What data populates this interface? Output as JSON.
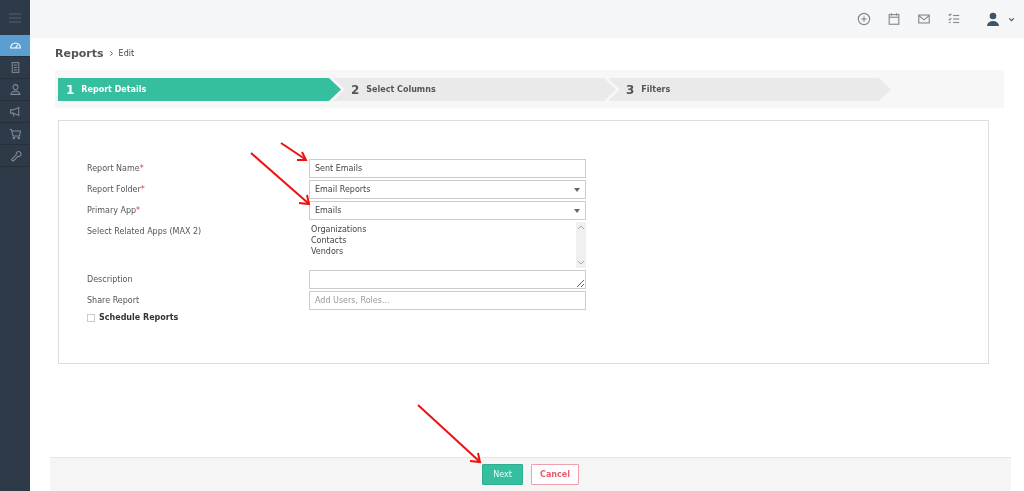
{
  "sidebar": {
    "items": [
      {
        "selected": true
      },
      {
        "selected": false
      },
      {
        "selected": false
      },
      {
        "selected": false
      },
      {
        "selected": false
      },
      {
        "selected": false
      }
    ]
  },
  "breadcrumb": {
    "title": "Reports",
    "current": "Edit"
  },
  "steps": [
    {
      "number": "1",
      "label": "Report Details",
      "selected": true
    },
    {
      "number": "2",
      "label": "Select Columns",
      "selected": false
    },
    {
      "number": "3",
      "label": "Filters",
      "selected": false
    }
  ],
  "form": {
    "fields": [
      {
        "kind": "text",
        "label": "Report Name",
        "required_mark": "*",
        "value": "Sent Emails"
      },
      {
        "kind": "select",
        "label": "Report Folder",
        "required_mark": "*",
        "value": "Email Reports"
      },
      {
        "kind": "select",
        "label": "Primary App",
        "required_mark": "*",
        "value": "Emails"
      },
      {
        "kind": "list",
        "label": "Select Related Apps (MAX 2)",
        "options": [
          "Organizations",
          "Contacts",
          "Vendors"
        ]
      },
      {
        "kind": "textarea",
        "label": "Description"
      },
      {
        "kind": "text",
        "label": "Share Report",
        "placeholder": "Add Users, Roles..."
      }
    ],
    "schedule": {
      "label": "Schedule Reports",
      "checked": false
    }
  },
  "buttons": [
    {
      "kind": "primary",
      "label": "Next"
    },
    {
      "kind": "cancel",
      "label": "Cancel"
    }
  ]
}
